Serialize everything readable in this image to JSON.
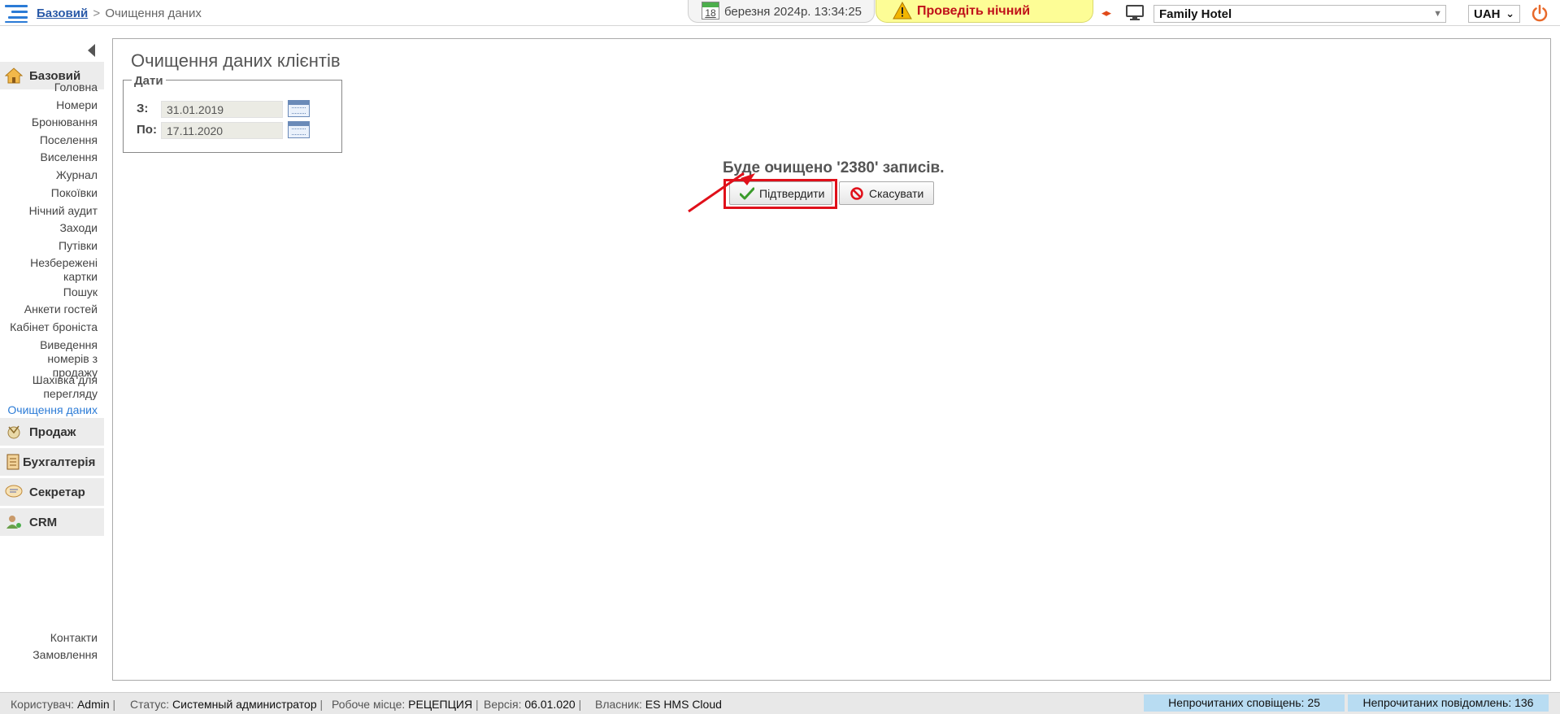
{
  "header": {
    "breadcrumb_home": "Базовий",
    "breadcrumb_sep": ">",
    "breadcrumb_current": "Очищення даних",
    "calendar_day": "18",
    "datetime": "березня 2024р.  13:34:25",
    "warning": "Проведіть нічний",
    "hotel": "Family Hotel",
    "currency": "UAH"
  },
  "sidebar": {
    "sections": [
      {
        "label": "Базовий",
        "icon": "home-icon"
      },
      {
        "label": "Продаж",
        "icon": "sale-icon"
      },
      {
        "label": "Бухгалтерія",
        "icon": "accounting-icon"
      },
      {
        "label": "Секретар",
        "icon": "secretary-icon"
      },
      {
        "label": "CRM",
        "icon": "crm-icon"
      }
    ],
    "base_items": [
      "Головна",
      "Номери",
      "Бронювання",
      "Поселення",
      "Виселення",
      "Журнал",
      "Покоївки",
      "Нічний аудит",
      "Заходи",
      "Путівки",
      "Незбережені картки",
      "Пошук",
      "Анкети гостей",
      "Кабінет броніста",
      "Виведення номерів з продажу",
      "Шахівка для перегляду",
      "Очищення даних"
    ],
    "crm_items": [
      "Контакти",
      "Замовлення"
    ]
  },
  "main": {
    "title": "Очищення даних клієнтів",
    "dates_legend": "Дати",
    "from_label": "З:",
    "from_value": "31.01.2019",
    "to_label": "По:",
    "to_value": "17.11.2020",
    "confirm_message": "Буде очищено '2380' записів.",
    "confirm_button": "Підтвердити",
    "cancel_button": "Скасувати"
  },
  "statusbar": {
    "user_label": "Користувач:",
    "user": "Admin",
    "status_label": "Статус:",
    "status": "Системный администратор",
    "workplace_label": "Робоче місце:",
    "workplace": "РЕЦЕПЦИЯ",
    "version_label": "Версія:",
    "version": "06.01.020",
    "owner_label": "Власник:",
    "owner": "ES HMS Cloud",
    "sep": "|",
    "unread_notifications": "Непрочитаних сповіщень: 25",
    "unread_messages": "Непрочитаних повідомлень: 136"
  },
  "colors": {
    "accent": "#2b7bd6",
    "warning_bg": "#fdfd96",
    "warning_text": "#c0111a",
    "highlight": "#e0101a",
    "badge_bg": "#b8dcf2"
  }
}
